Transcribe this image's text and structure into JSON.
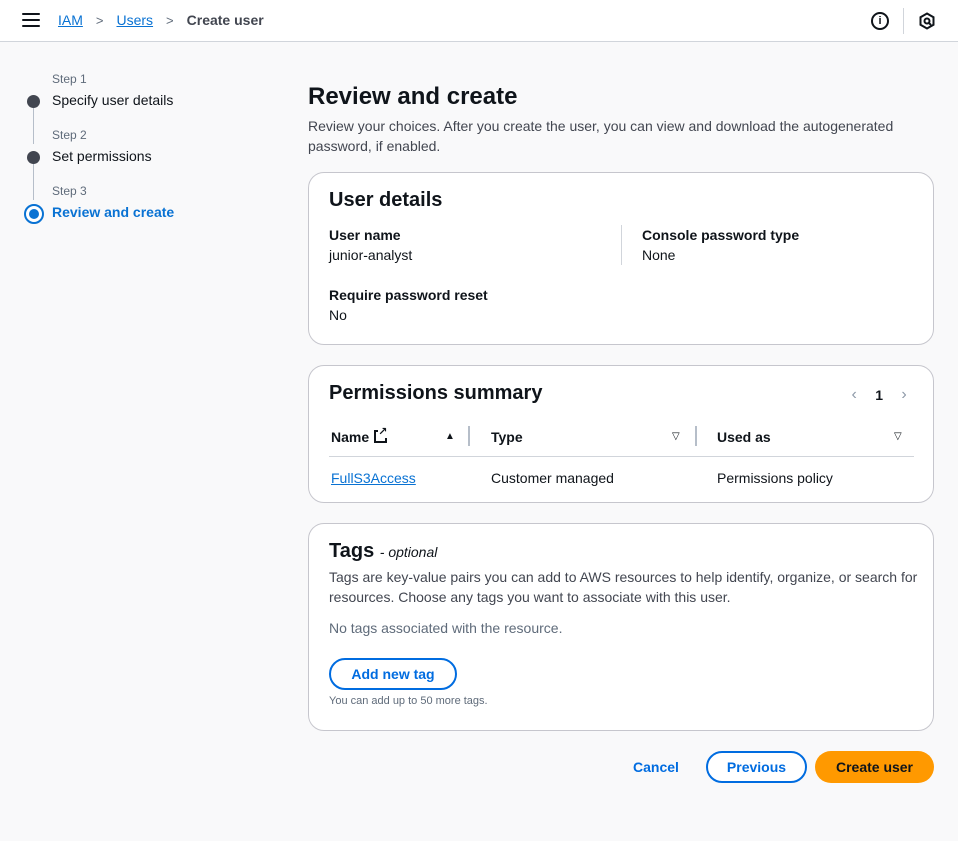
{
  "breadcrumb": {
    "items": [
      "IAM",
      "Users"
    ],
    "current": "Create user"
  },
  "steps": [
    {
      "number": "Step 1",
      "label": "Specify user details",
      "state": "completed"
    },
    {
      "number": "Step 2",
      "label": "Set permissions",
      "state": "completed"
    },
    {
      "number": "Step 3",
      "label": "Review and create",
      "state": "active"
    }
  ],
  "page": {
    "title": "Review and create",
    "description": "Review your choices. After you create the user, you can view and download the autogenerated password, if enabled."
  },
  "user_details": {
    "title": "User details",
    "user_name_label": "User name",
    "user_name_value": "junior-analyst",
    "console_password_label": "Console password type",
    "console_password_value": "None",
    "password_reset_label": "Require password reset",
    "password_reset_value": "No"
  },
  "permissions": {
    "title": "Permissions summary",
    "page": "1",
    "columns": [
      "Name",
      "Type",
      "Used as"
    ],
    "rows": [
      {
        "name": "FullS3Access",
        "type": "Customer managed",
        "used_as": "Permissions policy"
      }
    ]
  },
  "tags": {
    "title": "Tags",
    "optional": "- optional",
    "description": "Tags are key-value pairs you can add to AWS resources to help identify, organize, or search for resources. Choose any tags you want to associate with this user.",
    "empty": "No tags associated with the resource.",
    "add_button": "Add new tag",
    "hint": "You can add up to 50 more tags."
  },
  "footer": {
    "cancel": "Cancel",
    "previous": "Previous",
    "create": "Create user"
  },
  "colors": {
    "accent": "#0972d3",
    "primary_button": "#ff9900"
  }
}
